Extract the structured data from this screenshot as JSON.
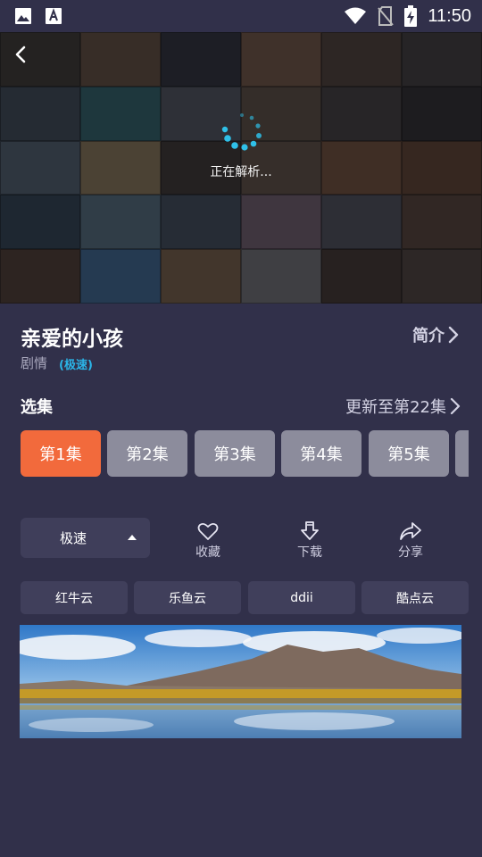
{
  "status_bar": {
    "time": "11:50",
    "icons": [
      "gallery-icon",
      "font-download-icon",
      "wifi-icon",
      "no-sim-icon",
      "battery-charging-icon"
    ]
  },
  "player": {
    "loading_text": "正在解析...",
    "icons": [
      "back-arrow-icon",
      "loading-spinner-icon"
    ]
  },
  "info": {
    "title": "亲爱的小孩",
    "genre": "剧情",
    "source_tag": "(极速)",
    "intro_label": "简介"
  },
  "episodes": {
    "section_title": "选集",
    "update_text": "更新至第22集",
    "items": [
      "第1集",
      "第2集",
      "第3集",
      "第4集",
      "第5集"
    ],
    "selected": "第1集"
  },
  "controls": {
    "speed_selected": "极速",
    "actions": [
      {
        "icon": "heart-icon",
        "label": "收藏"
      },
      {
        "icon": "download-icon",
        "label": "下载"
      },
      {
        "icon": "share-icon",
        "label": "分享"
      }
    ]
  },
  "sources": [
    "红牛云",
    "乐鱼云",
    "ddii",
    "酷点云"
  ],
  "colors": {
    "background": "#31304a",
    "accent_orange": "#f26a3c",
    "accent_blue": "#2bb5e8",
    "episode_button": "#8c8c9c",
    "source_button": "#403f5b"
  }
}
